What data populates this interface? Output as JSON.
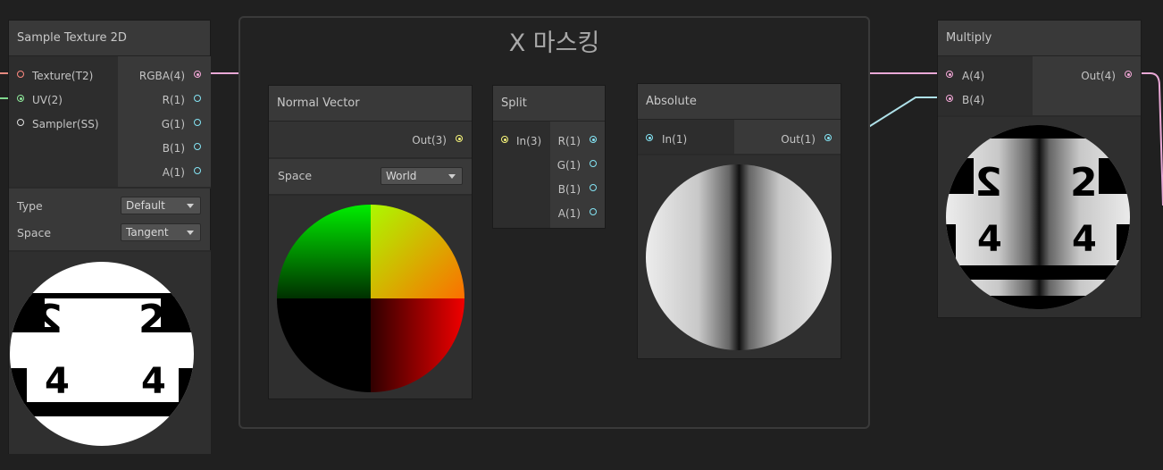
{
  "group": {
    "title": "X 마스킹"
  },
  "sample_texture": {
    "title": "Sample Texture 2D",
    "inputs": [
      "Texture(T2)",
      "UV(2)",
      "Sampler(SS)"
    ],
    "outputs": [
      "RGBA(4)",
      "R(1)",
      "G(1)",
      "B(1)",
      "A(1)"
    ],
    "type_label": "Type",
    "type_value": "Default",
    "space_label": "Space",
    "space_value": "Tangent",
    "preview_text": [
      "2",
      "2",
      "4",
      "4"
    ]
  },
  "normal_vector": {
    "title": "Normal Vector",
    "output": "Out(3)",
    "space_label": "Space",
    "space_value": "World"
  },
  "split": {
    "title": "Split",
    "input": "In(3)",
    "outputs": [
      "R(1)",
      "G(1)",
      "B(1)",
      "A(1)"
    ]
  },
  "absolute": {
    "title": "Absolute",
    "input": "In(1)",
    "output": "Out(1)"
  },
  "multiply": {
    "title": "Multiply",
    "inputs": [
      "A(4)",
      "B(4)"
    ],
    "output": "Out(4)",
    "preview_text": [
      "2",
      "2",
      "4",
      "4"
    ]
  },
  "colors": {
    "background": "#202020",
    "node": "#393939",
    "vec4_port": "#f4a8d8",
    "vec3_port": "#f5f37a",
    "vec2_port": "#8ee89a",
    "vec1_port": "#84e4f4",
    "texture_port": "#ff8a80",
    "sampler_port": "#e0e0e0"
  },
  "icons": [
    "port-dot-icon",
    "dropdown-caret-icon"
  ]
}
